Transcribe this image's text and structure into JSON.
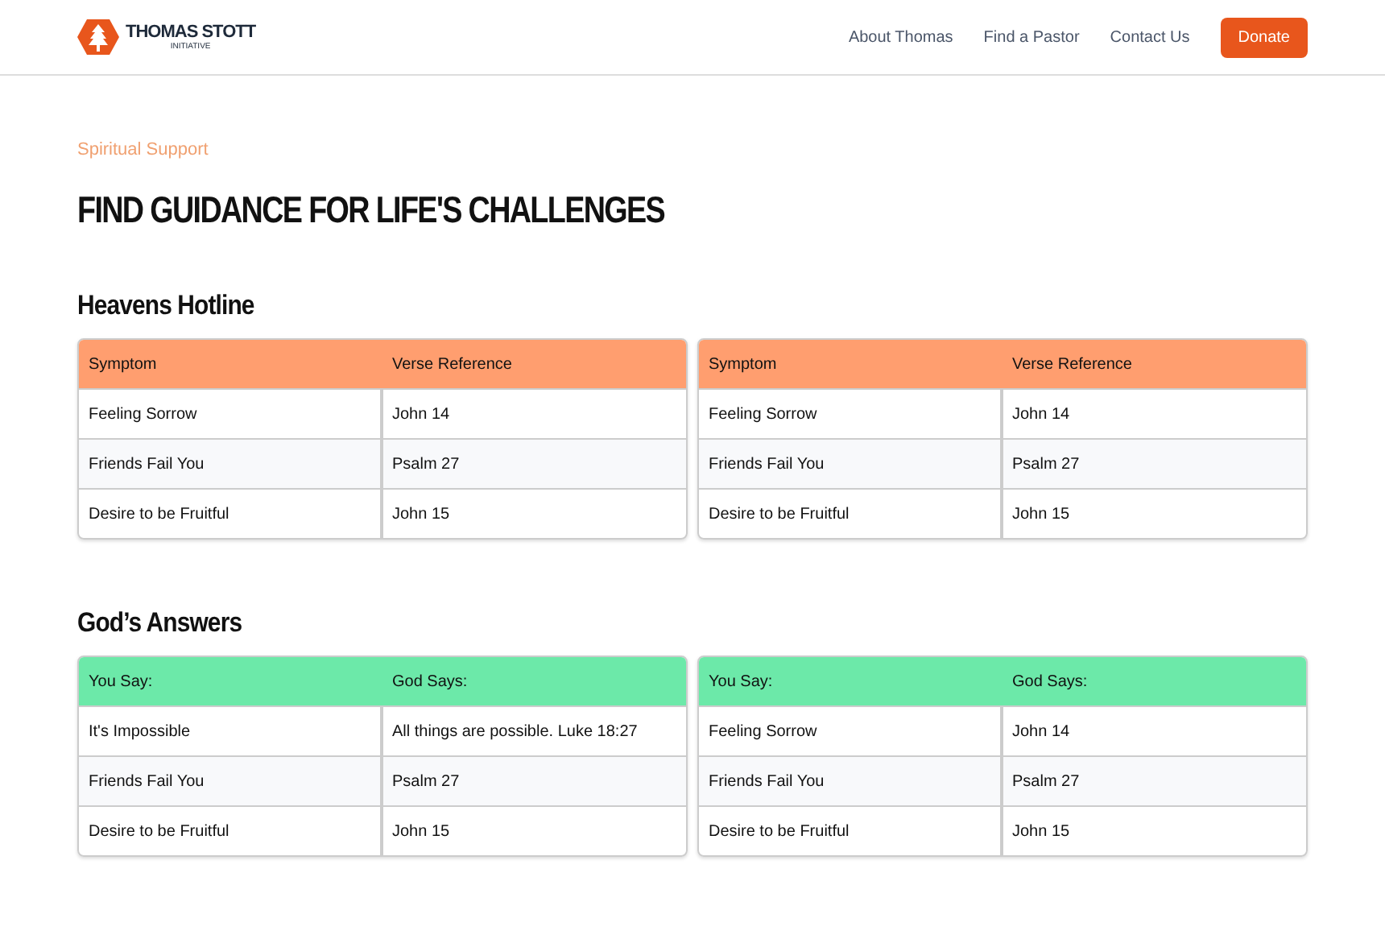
{
  "header": {
    "logo": {
      "name": "THOMAS STOTT",
      "tagline": "INITIATIVE"
    },
    "nav": [
      "About Thomas",
      "Find a Pastor",
      "Contact Us"
    ],
    "cta": "Donate"
  },
  "eyebrow": "Spiritual Support",
  "title": "FIND GUIDANCE FOR LIFE'S CHALLENGES",
  "sections": [
    {
      "heading": "Heavens Hotline",
      "color": "#ff9e6f",
      "tables": [
        {
          "columns": [
            "Symptom",
            "Verse Reference"
          ],
          "rows": [
            [
              "Feeling Sorrow",
              "John 14"
            ],
            [
              "Friends Fail You",
              "Psalm 27"
            ],
            [
              "Desire to be Fruitful",
              "John 15"
            ]
          ]
        },
        {
          "columns": [
            "Symptom",
            "Verse Reference"
          ],
          "rows": [
            [
              "Feeling Sorrow",
              "John 14"
            ],
            [
              "Friends Fail You",
              "Psalm 27"
            ],
            [
              "Desire to be Fruitful",
              "John 15"
            ]
          ]
        }
      ]
    },
    {
      "heading": "God’s Answers",
      "color": "#6ce9a9",
      "tables": [
        {
          "columns": [
            "You Say:",
            "God Says:"
          ],
          "rows": [
            [
              "It's Impossible",
              "All things are possible. Luke 18:27"
            ],
            [
              "Friends Fail You",
              "Psalm 27"
            ],
            [
              "Desire to be Fruitful",
              "John 15"
            ]
          ]
        },
        {
          "columns": [
            "You Say:",
            "God Says:"
          ],
          "rows": [
            [
              "Feeling Sorrow",
              "John 14"
            ],
            [
              "Friends Fail You",
              "Psalm 27"
            ],
            [
              "Desire to be Fruitful",
              "John 15"
            ]
          ]
        }
      ]
    }
  ]
}
